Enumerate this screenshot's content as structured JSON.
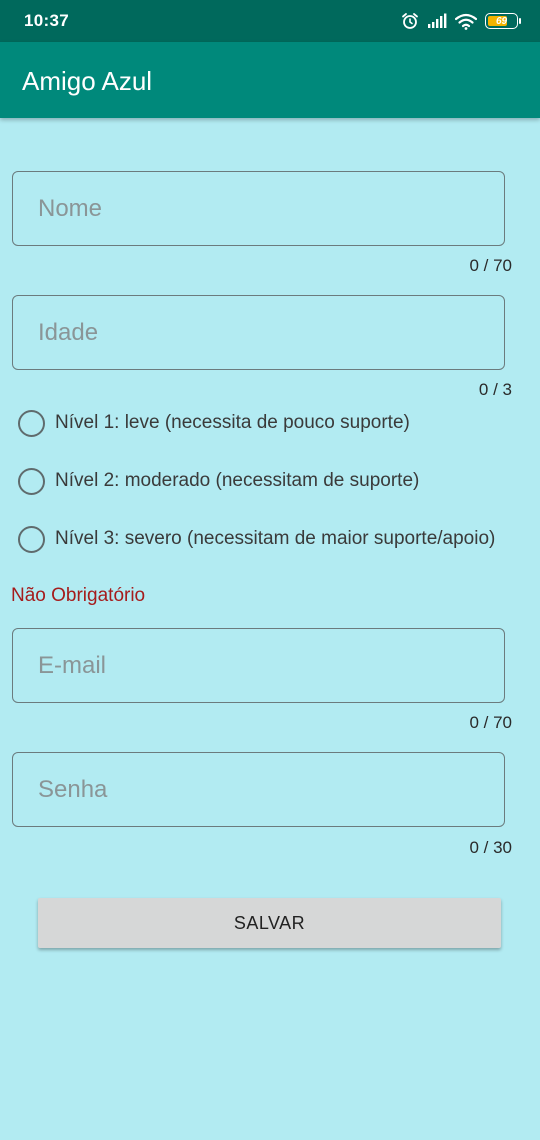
{
  "status_bar": {
    "time": "10:37",
    "battery_level": "69",
    "icons": [
      "alarm-icon",
      "signal-icon",
      "wifi-icon",
      "battery-icon"
    ]
  },
  "app_bar": {
    "title": "Amigo Azul"
  },
  "form": {
    "name_field": {
      "placeholder": "Nome",
      "value": "",
      "counter": "0 / 70"
    },
    "age_field": {
      "placeholder": "Idade",
      "value": "",
      "counter": "0 / 3"
    },
    "levels": [
      {
        "label": "Nível 1: leve (necessita de pouco suporte)",
        "selected": false
      },
      {
        "label": "Nível 2: moderado (necessitam de suporte)",
        "selected": false
      },
      {
        "label": "Nível 3: severo (necessitam de maior suporte/apoio)",
        "selected": false
      }
    ],
    "optional_label": "Não Obrigatório",
    "email_field": {
      "placeholder": "E-mail",
      "value": "",
      "counter": "0 / 70"
    },
    "password_field": {
      "placeholder": "Senha",
      "value": "",
      "counter": "0 / 30"
    },
    "save_label": "SALVAR"
  },
  "colors": {
    "background": "#b2ebf2",
    "status_bar": "#00695c",
    "app_bar": "#00897b",
    "optional_text": "#a51c1c",
    "button": "#d6d7d7"
  }
}
